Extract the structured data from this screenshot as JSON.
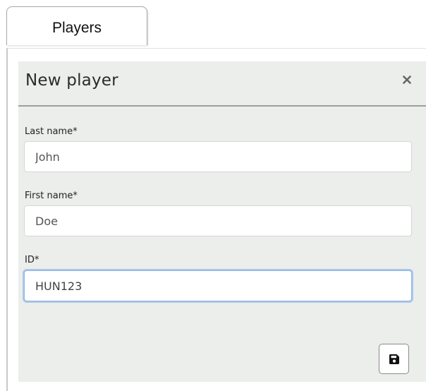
{
  "tabs": [
    {
      "label": "Players",
      "active": true
    }
  ],
  "modal": {
    "title": "New player",
    "close_icon": "close-icon",
    "fields": [
      {
        "label": "Last name*",
        "value": "John",
        "focused": false
      },
      {
        "label": "First name*",
        "value": "Doe",
        "focused": false
      },
      {
        "label": "ID*",
        "value": "HUN123",
        "focused": true
      }
    ],
    "save_icon": "floppy-disk-icon"
  },
  "colors": {
    "modal_background": "#eceeeb",
    "focus_ring": "#8db5e6",
    "header_divider": "#9aa09d"
  }
}
